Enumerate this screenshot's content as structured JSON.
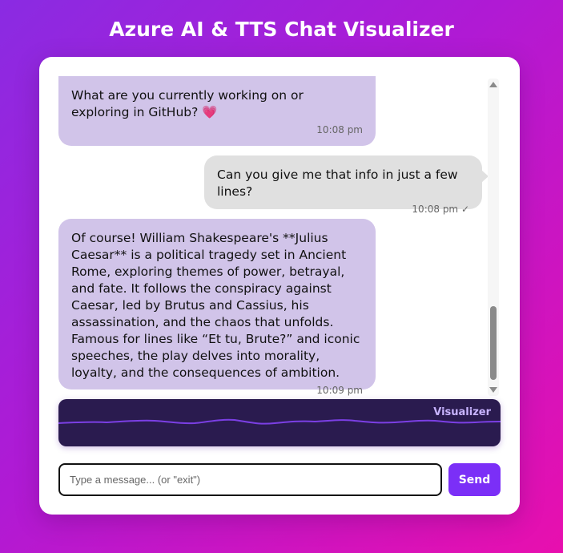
{
  "app": {
    "title": "Azure AI & TTS Chat Visualizer"
  },
  "messages": [
    {
      "role": "bot",
      "text": "What are you currently working on or exploring in GitHub? 💗",
      "time": "10:08 pm"
    },
    {
      "role": "user",
      "text": "Can you give me that info in just a few lines?",
      "time": "10:08 pm ✓"
    },
    {
      "role": "bot",
      "text": "Of course! William Shakespeare's **Julius Caesar** is a political tragedy set in Ancient Rome, exploring themes of power, betrayal, and fate. It follows the conspiracy against Caesar, led by Brutus and Cassius, his assassination, and the chaos that unfolds. Famous for lines like “Et tu, Brute?” and iconic speeches, the play delves into morality, loyalty, and the consequences of ambition.",
      "time": "10:09 pm"
    }
  ],
  "visualizer": {
    "label": "Visualizer",
    "wave_color": "#7b3fe4"
  },
  "composer": {
    "placeholder": "Type a message... (or \"exit\")",
    "value": "",
    "send_label": "Send"
  },
  "colors": {
    "bot_bubble": "#d1c4e9",
    "user_bubble": "#e0e0e0",
    "accent": "#7b2ff7"
  }
}
